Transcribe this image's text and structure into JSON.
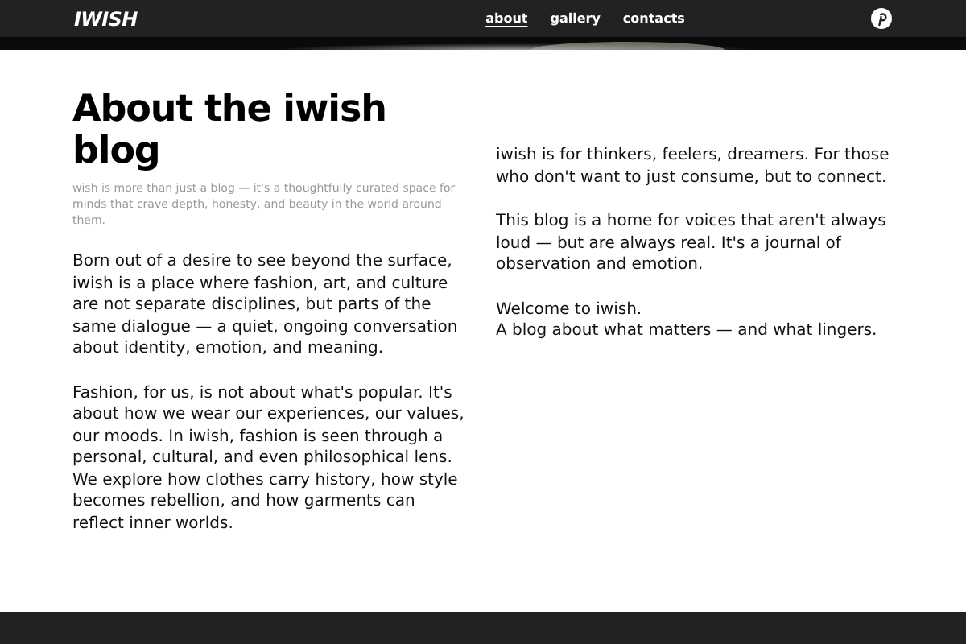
{
  "header": {
    "logo": "IWISH",
    "nav": [
      {
        "label": "about",
        "selected": true
      },
      {
        "label": "gallery",
        "selected": false
      },
      {
        "label": "contacts",
        "selected": false
      }
    ]
  },
  "about": {
    "title": "About the iwish blog",
    "subtitle": "wish is more than just a blog — it's a thoughtfully curated space for minds that crave depth, honesty, and beauty in the world around them.",
    "left_paragraphs": [
      "Born out of a desire to see beyond the surface, iwish is a place where fashion, art, and culture are not separate disciplines, but parts of the same dialogue — a quiet, ongoing conversation about identity, emotion, and meaning.",
      "Fashion, for us, is not about what's popular. It's about how we wear our experiences, our values, our moods. In iwish, fashion is seen through a personal, cultural, and even philosophical lens. We explore how clothes carry history, how style becomes rebellion, and how garments can reflect inner worlds."
    ],
    "right_paragraphs": [
      [
        "iwish is for thinkers, feelers, dreamers. For those who don't want to just consume, but to connect."
      ],
      [
        "This blog is a home for voices that aren't always loud — but are always real. It's a journal of observation and emotion."
      ],
      [
        "Welcome to iwish.",
        "A blog about what matters — and what lingers."
      ]
    ]
  }
}
